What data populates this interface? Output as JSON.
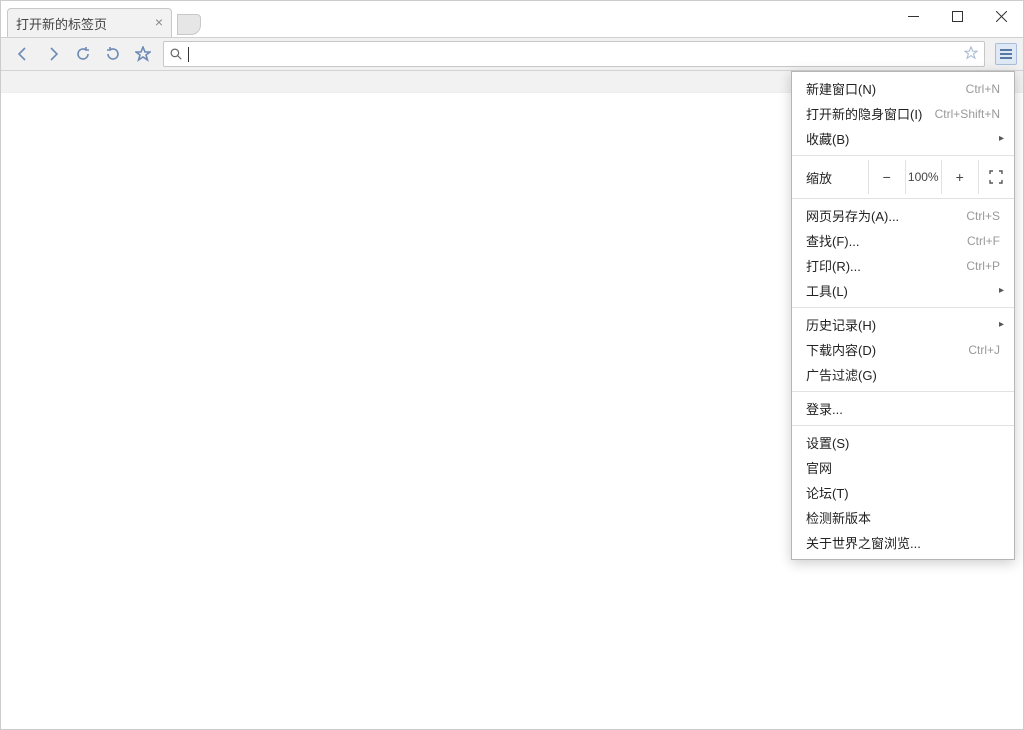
{
  "tab": {
    "title": "打开新的标签页"
  },
  "zoom": {
    "label": "缩放",
    "value": "100%"
  },
  "menu": {
    "new_window": {
      "label": "新建窗口(N)",
      "short": "Ctrl+N"
    },
    "incognito": {
      "label": "打开新的隐身窗口(I)",
      "short": "Ctrl+Shift+N"
    },
    "bookmarks": {
      "label": "收藏(B)"
    },
    "save_as": {
      "label": "网页另存为(A)...",
      "short": "Ctrl+S"
    },
    "find": {
      "label": "查找(F)...",
      "short": "Ctrl+F"
    },
    "print": {
      "label": "打印(R)...",
      "short": "Ctrl+P"
    },
    "tools": {
      "label": "工具(L)"
    },
    "history": {
      "label": "历史记录(H)"
    },
    "downloads": {
      "label": "下载内容(D)",
      "short": "Ctrl+J"
    },
    "adblock": {
      "label": "广告过滤(G)"
    },
    "signin": {
      "label": "登录..."
    },
    "settings": {
      "label": "设置(S)"
    },
    "homepage": {
      "label": "官网"
    },
    "forum": {
      "label": "论坛(T)"
    },
    "update": {
      "label": "检测新版本"
    },
    "about": {
      "label": "关于世界之窗浏览..."
    }
  }
}
